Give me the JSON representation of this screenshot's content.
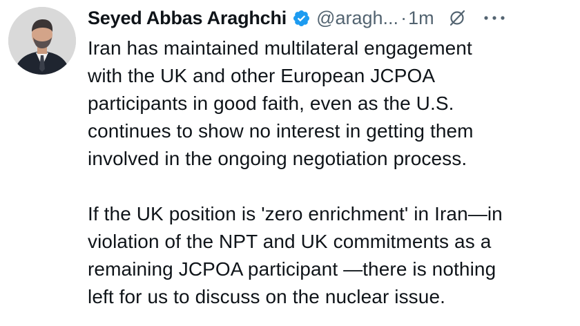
{
  "tweet": {
    "author": {
      "display_name": "Seyed Abbas Araghchi",
      "handle": "@aragh...",
      "verified_icon": "verified-badge-icon",
      "avatar": "author-avatar"
    },
    "separator": "·",
    "timestamp": "1m",
    "icons": {
      "grok": "grok-slash-icon",
      "more": "more-options-icon"
    },
    "paragraphs": [
      {
        "lines": [
          "Iran has maintained multilateral engagement",
          "with the UK and other European JCPOA",
          "participants in good faith, even as the U.S.",
          "continues to show no interest in getting them",
          "involved in the ongoing negotiation process."
        ]
      },
      {
        "lines": [
          "If the UK position is 'zero enrichment' in Iran—in",
          "violation of the NPT and UK commitments as a",
          "remaining JCPOA participant —there is nothing",
          "left for us to discuss on the nuclear issue."
        ]
      }
    ]
  },
  "colors": {
    "text": "#0f1419",
    "secondary": "#536471",
    "verified": "#1d9bf0"
  }
}
